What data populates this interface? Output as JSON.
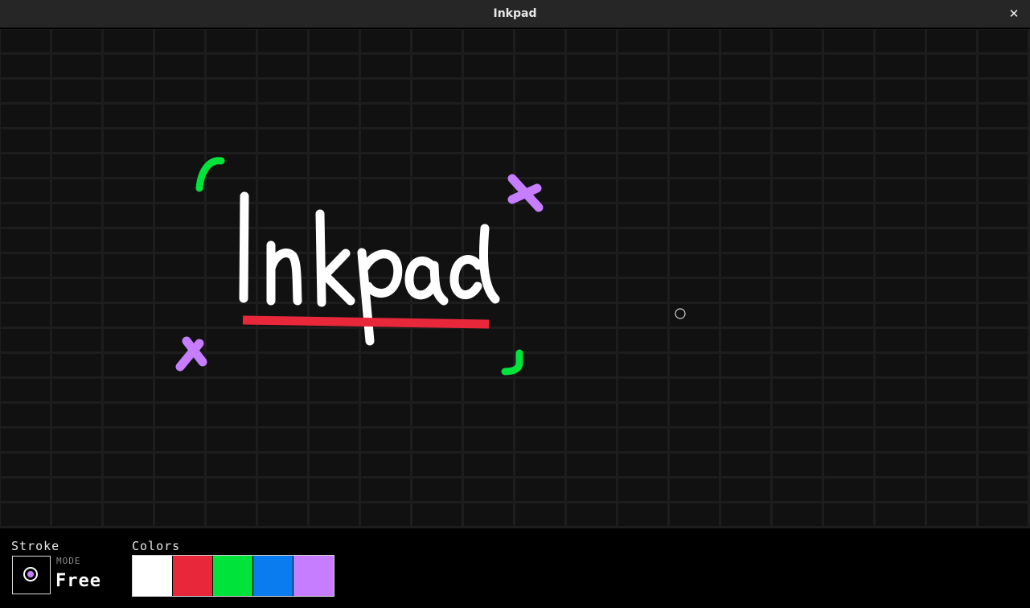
{
  "window": {
    "title": "Inkpad",
    "close_symbol": "✕"
  },
  "canvas": {
    "background_color": "#111111",
    "drawn_text": "Inkpad",
    "strokes": [
      {
        "name": "handwritten-inkpad-text",
        "color": "#ffffff"
      },
      {
        "name": "red-underline",
        "color": "#e8283a"
      },
      {
        "name": "green-bracket-top-left",
        "color": "#00e33a"
      },
      {
        "name": "green-bracket-bottom-right",
        "color": "#00e33a"
      },
      {
        "name": "purple-x-top-right",
        "color": "#c77dff"
      },
      {
        "name": "purple-x-bottom-left",
        "color": "#c77dff"
      }
    ]
  },
  "toolbar": {
    "stroke_label": "Stroke",
    "mode_caption": "MODE",
    "mode_value": "Free",
    "mode_dot_color": "#c77dff",
    "colors_label": "Colors",
    "swatches": [
      {
        "name": "white",
        "color": "#ffffff"
      },
      {
        "name": "red",
        "color": "#e8283a"
      },
      {
        "name": "green",
        "color": "#00e33a"
      },
      {
        "name": "blue",
        "color": "#0a7cf0"
      },
      {
        "name": "purple",
        "color": "#c77dff"
      }
    ]
  }
}
